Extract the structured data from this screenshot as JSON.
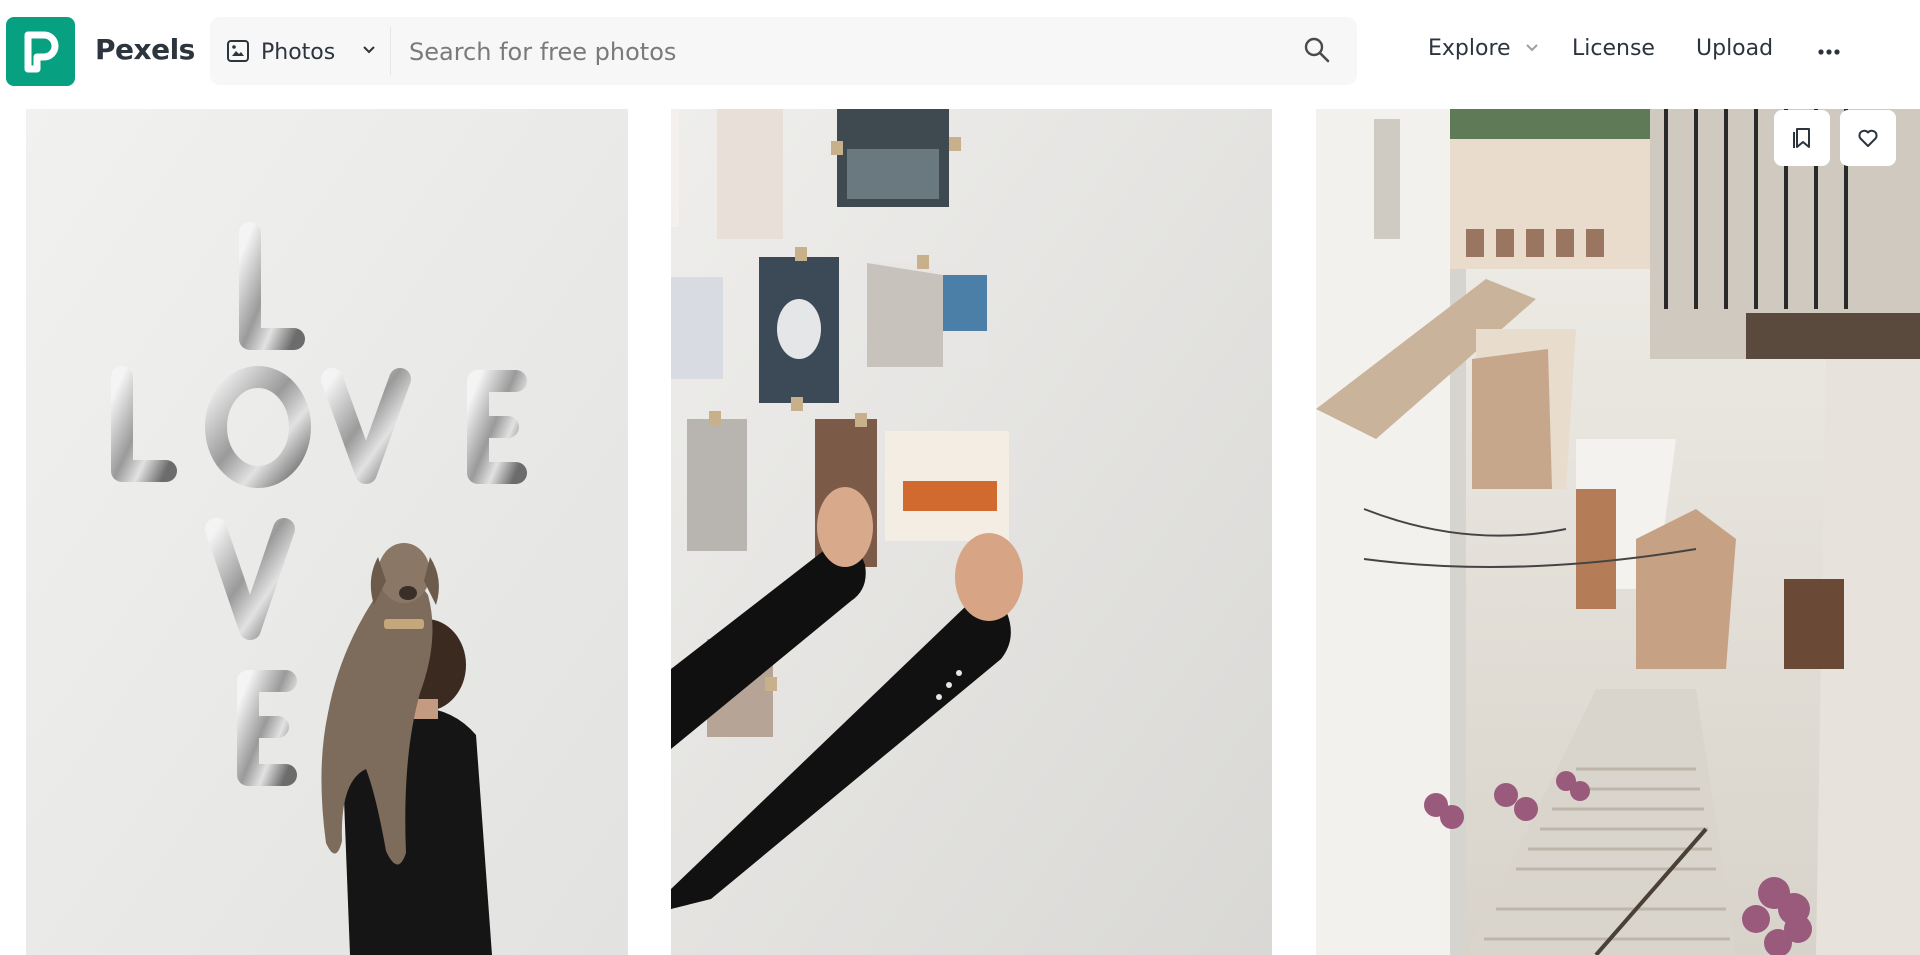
{
  "brand": {
    "name": "Pexels",
    "logo_letter": "P"
  },
  "search": {
    "type_label": "Photos",
    "placeholder": "Search for free photos"
  },
  "nav": {
    "explore": "Explore",
    "license": "License",
    "upload": "Upload"
  },
  "photos": [
    {
      "subject": "man holding dog under LOVE balloons",
      "balloon_letters": "LOVE"
    },
    {
      "subject": "hands pinning photos on wall"
    },
    {
      "subject": "narrow whitewashed street with stairs"
    }
  ],
  "colors": {
    "accent": "#07a081",
    "text": "#2c343e",
    "search_bg": "#f7f7f7"
  },
  "icons": [
    "image-icon",
    "chevron-down-icon",
    "search-icon",
    "more-icon",
    "collect-icon",
    "heart-icon"
  ]
}
